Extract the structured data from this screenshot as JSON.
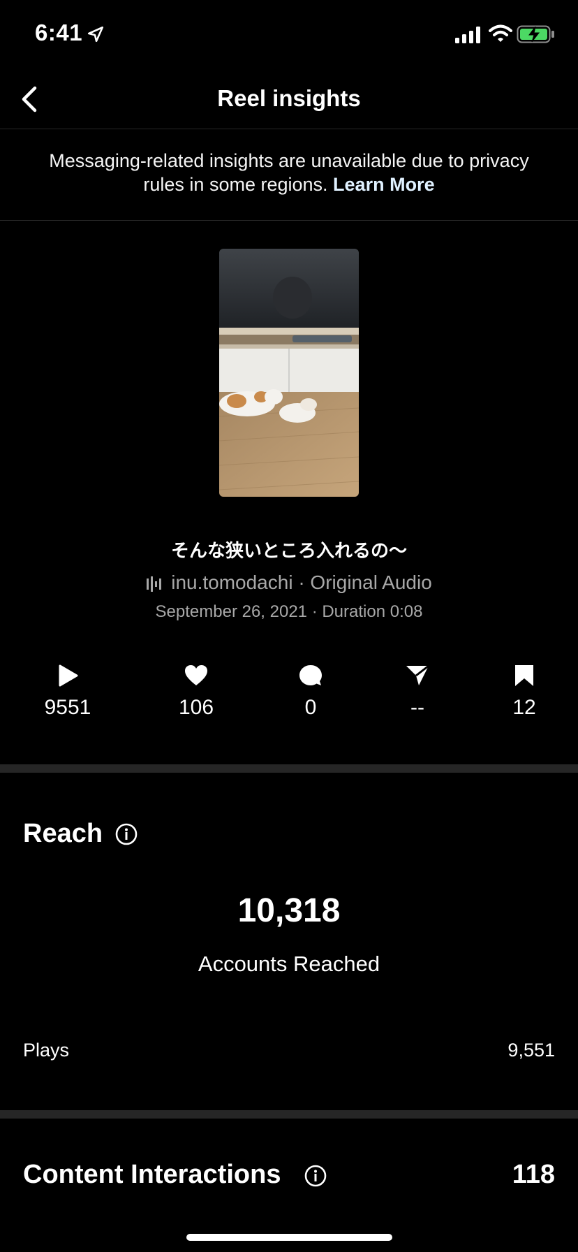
{
  "status_bar": {
    "time": "6:41"
  },
  "nav": {
    "title": "Reel insights"
  },
  "notice": {
    "text": "Messaging-related insights are unavailable due to privacy rules in some regions.",
    "link": "Learn More"
  },
  "reel": {
    "caption": "そんな狭いところ入れるの〜",
    "audio": "inu.tomodachi · Original Audio",
    "date_duration": "September 26, 2021 · Duration 0:08"
  },
  "stats": {
    "plays": "9551",
    "likes": "106",
    "comments": "0",
    "shares": "--",
    "saves": "12"
  },
  "reach": {
    "title": "Reach",
    "accounts_reached": "10,318",
    "accounts_reached_label": "Accounts Reached",
    "plays_label": "Plays",
    "plays_value": "9,551"
  },
  "content_interactions": {
    "title": "Content Interactions",
    "value": "118"
  },
  "colors": {
    "background": "#000000",
    "divider": "#262626",
    "secondary_text": "#a8a8a8",
    "battery_charging": "#4cd964"
  }
}
